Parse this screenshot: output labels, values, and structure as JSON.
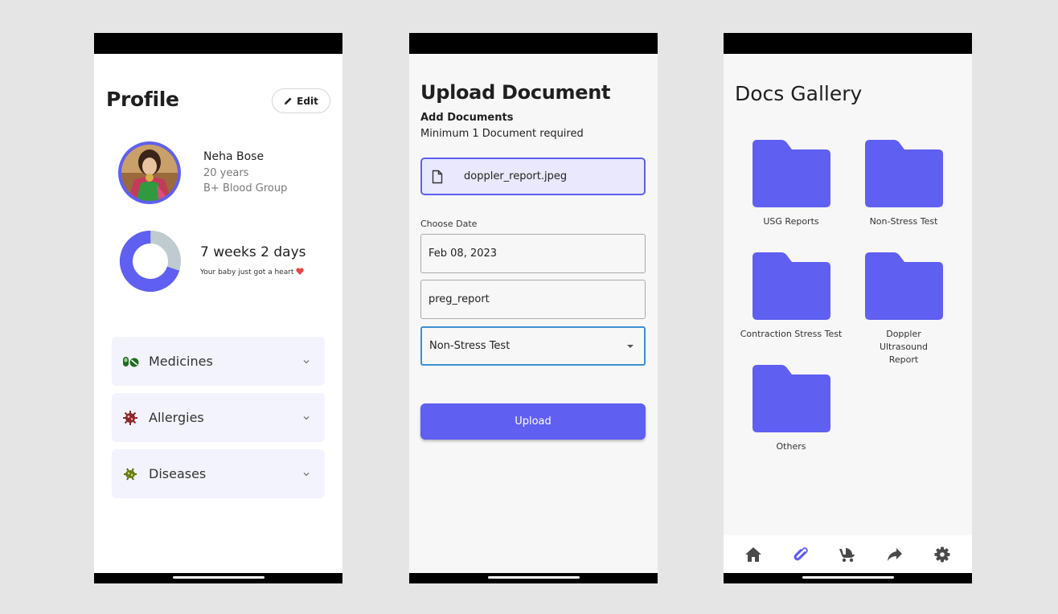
{
  "profile": {
    "title": "Profile",
    "edit_label": "Edit",
    "name": "Neha Bose",
    "age": "20 years",
    "blood_group": "B+ Blood Group",
    "pregnancy_progress_fraction": 0.7,
    "weeks": "7 weeks 2 days",
    "message": "Your baby just got a heart",
    "sections": [
      {
        "label": "Medicines",
        "icon": "pills-icon"
      },
      {
        "label": "Allergies",
        "icon": "virus-icon"
      },
      {
        "label": "Diseases",
        "icon": "bacteria-icon"
      }
    ],
    "colors": {
      "accent": "#5f5ff1",
      "ring_bg": "#bfcbcf"
    }
  },
  "upload": {
    "title": "Upload Document",
    "subtitle": "Add Documents",
    "requirement": "Minimum 1 Document required",
    "file_name": "doppler_report.jpeg",
    "date_label": "Choose Date",
    "date_value": "Feb 08, 2023",
    "name_value": "preg_report",
    "category_value": "Non-Stress Test",
    "button_label": "Upload"
  },
  "gallery": {
    "title": "Docs Gallery",
    "folders": [
      {
        "label": "USG Reports"
      },
      {
        "label": "Non-Stress Test"
      },
      {
        "label": "Contraction Stress Test"
      },
      {
        "label": "Doppler Ultrasound Report"
      },
      {
        "label": "Others"
      }
    ],
    "nav": [
      "home-icon",
      "paperclip-icon",
      "baby-carriage-icon",
      "share-icon",
      "gear-icon"
    ],
    "active_nav": "paperclip-icon"
  }
}
